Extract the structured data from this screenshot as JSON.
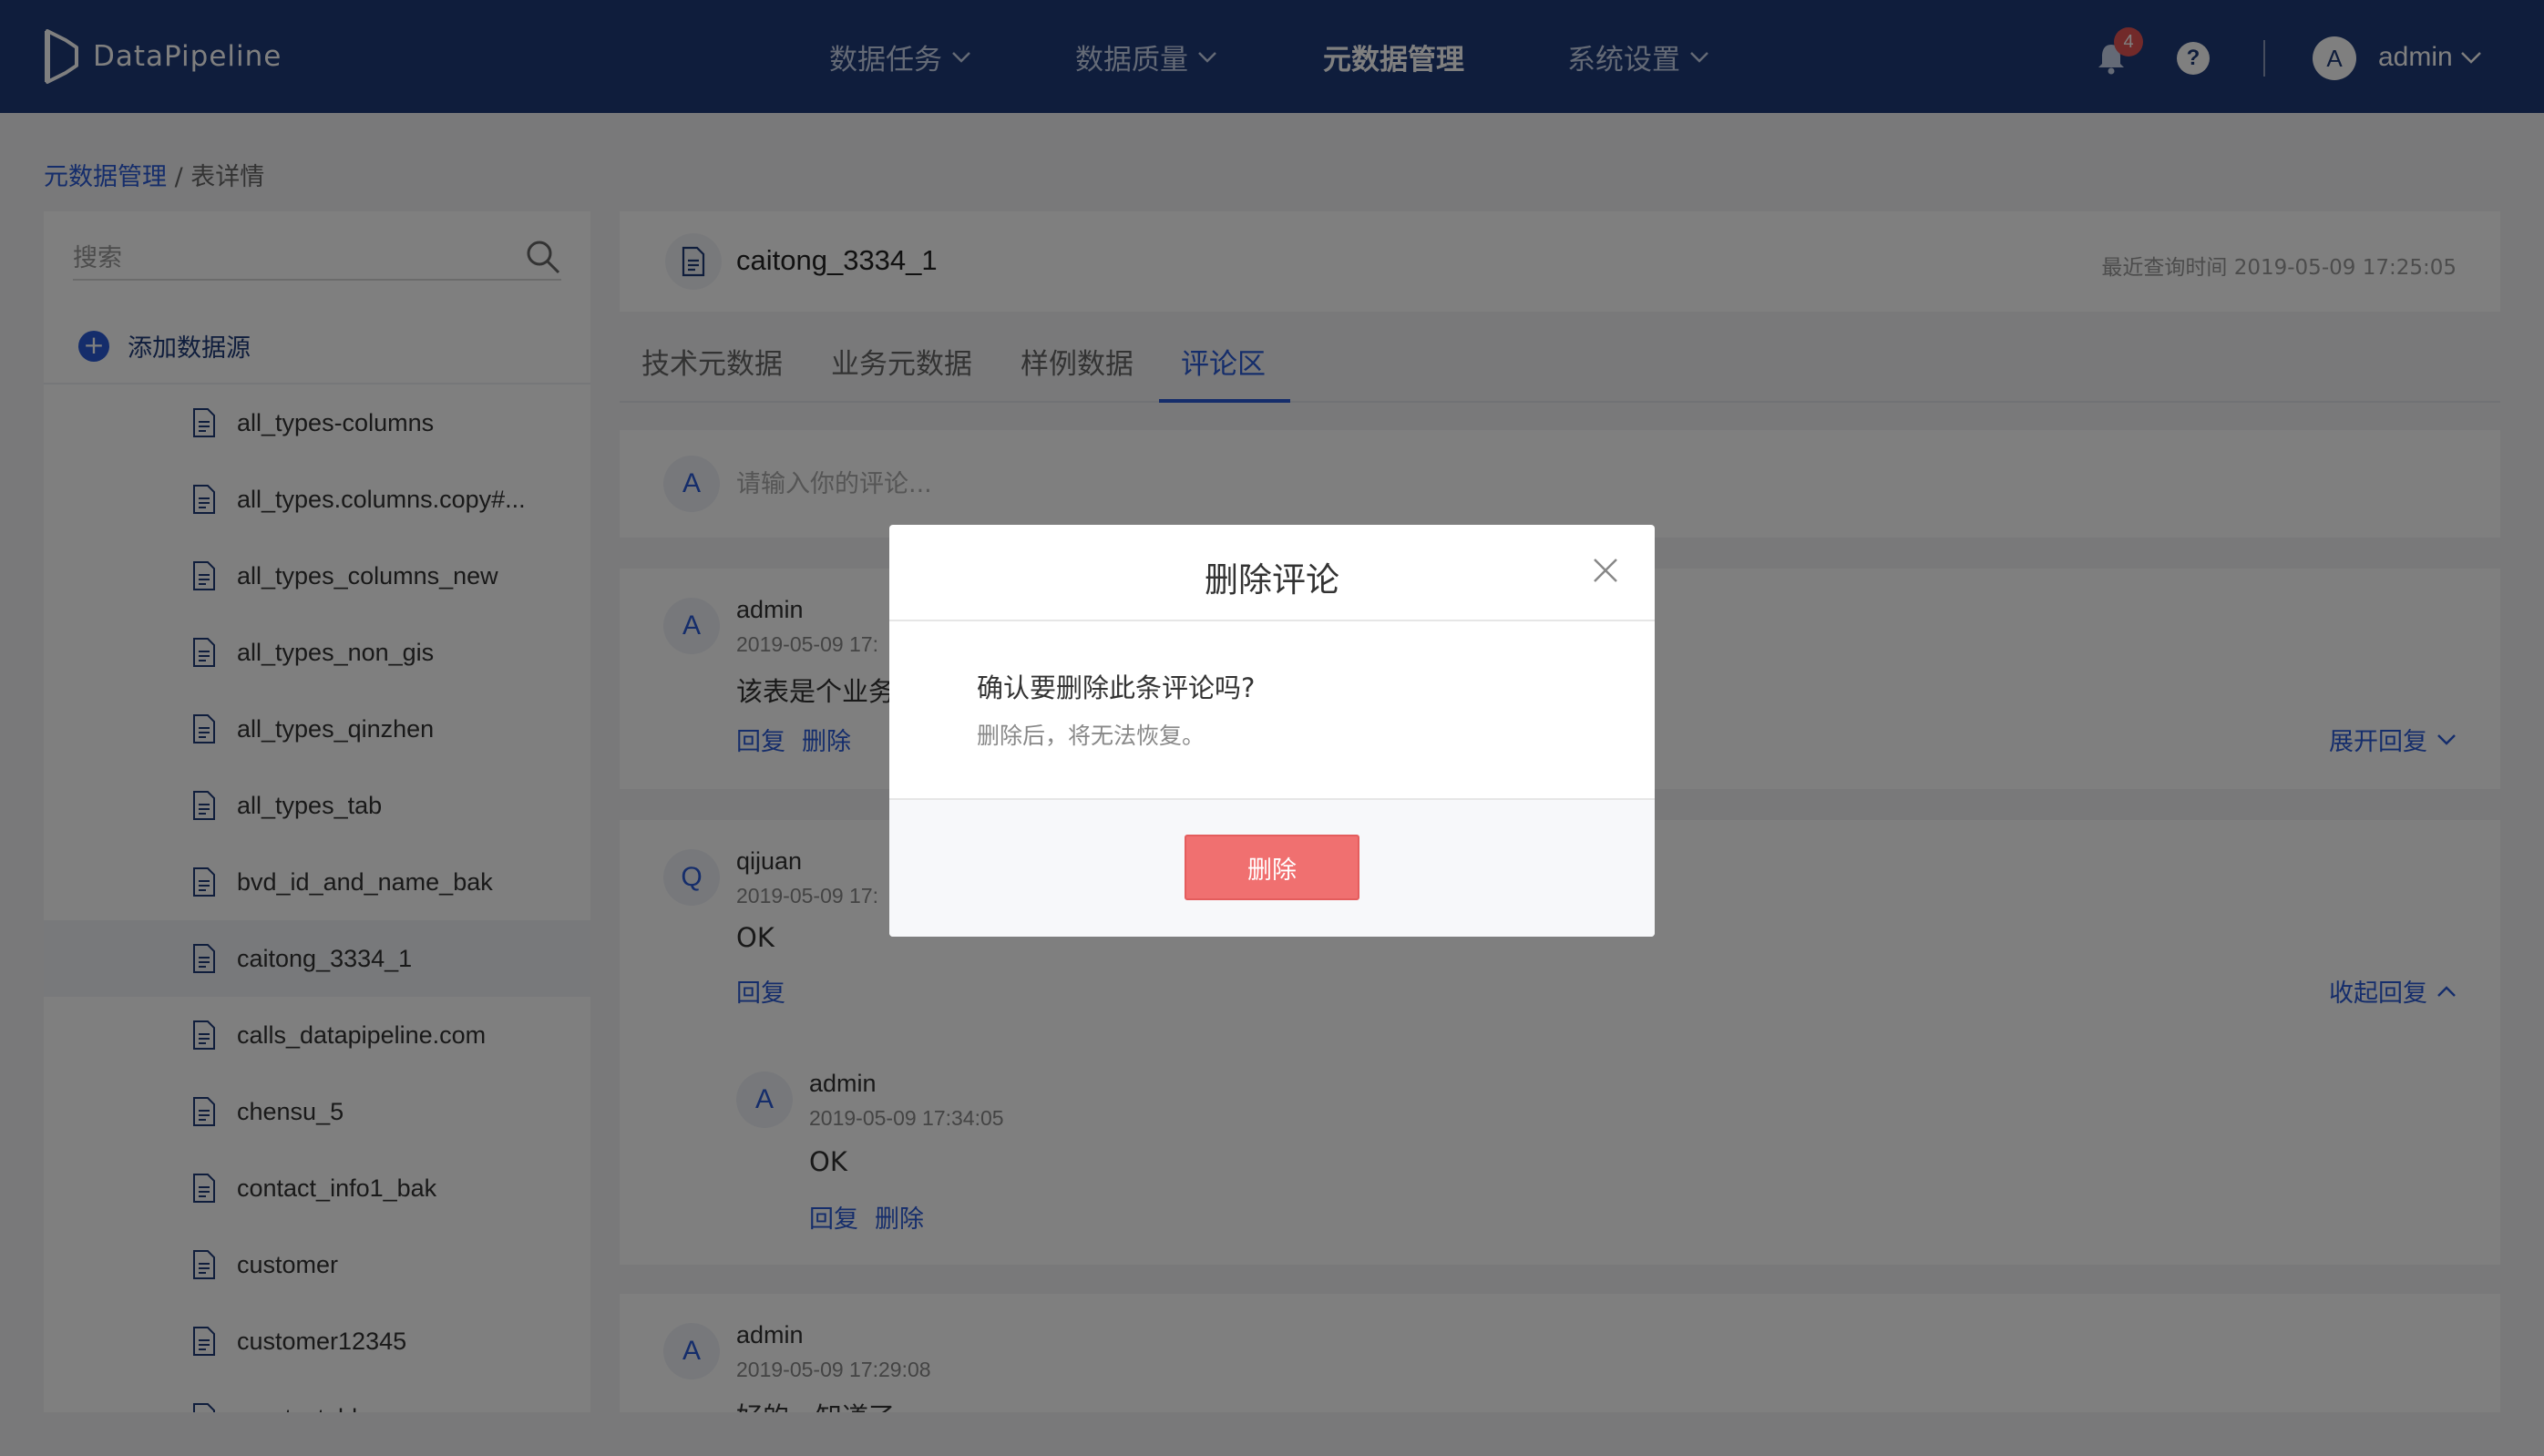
{
  "app": {
    "name": "DataPipeline"
  },
  "nav": {
    "items": [
      {
        "label": "数据任务"
      },
      {
        "label": "数据质量"
      },
      {
        "label": "元数据管理"
      },
      {
        "label": "系统设置"
      }
    ],
    "notification_count": "4",
    "help": "?",
    "user_initial": "A",
    "user_name": "admin"
  },
  "breadcrumb": {
    "parent": "元数据管理",
    "separator": "/",
    "current": "表详情"
  },
  "sidebar": {
    "search_placeholder": "搜索",
    "add_source_label": "添加数据源",
    "add_source_icon": "+",
    "items": [
      {
        "label": "all_types-columns"
      },
      {
        "label": "all_types.columns.copy#..."
      },
      {
        "label": "all_types_columns_new"
      },
      {
        "label": "all_types_non_gis"
      },
      {
        "label": "all_types_qinzhen"
      },
      {
        "label": "all_types_tab"
      },
      {
        "label": "bvd_id_and_name_bak"
      },
      {
        "label": "caitong_3334_1",
        "active": true
      },
      {
        "label": "calls_datapipeline.com"
      },
      {
        "label": "chensu_5"
      },
      {
        "label": "contact_info1_bak"
      },
      {
        "label": "customer"
      },
      {
        "label": "customer12345"
      },
      {
        "label": "empty_table"
      }
    ]
  },
  "detail": {
    "table_name": "caitong_3334_1",
    "last_query": "最近查询时间 2019-05-09 17:25:05",
    "tabs": [
      {
        "label": "技术元数据"
      },
      {
        "label": "业务元数据"
      },
      {
        "label": "样例数据"
      },
      {
        "label": "评论区",
        "active": true
      }
    ]
  },
  "comments": {
    "input_avatar": "A",
    "input_placeholder": "请输入你的评论...",
    "list": [
      {
        "avatar": "A",
        "author": "admin",
        "time": "2019-05-09 17:",
        "text": "该表是个业务",
        "reply": "回复",
        "delete": "删除",
        "toggle": "展开回复"
      },
      {
        "avatar": "Q",
        "author": "qijuan",
        "time": "2019-05-09 17:",
        "text": "OK",
        "reply": "回复",
        "toggle": "收起回复",
        "replies": [
          {
            "avatar": "A",
            "author": "admin",
            "time": "2019-05-09 17:34:05",
            "text": "OK",
            "reply": "回复",
            "delete": "删除"
          }
        ]
      },
      {
        "avatar": "A",
        "author": "admin",
        "time": "2019-05-09 17:29:08",
        "text": "好的，知道了"
      }
    ]
  },
  "modal": {
    "title": "删除评论",
    "message": "确认要删除此条评论吗?",
    "submessage": "删除后，将无法恢复。",
    "confirm_label": "删除",
    "close_icon": "close-icon"
  },
  "colors": {
    "nav_bg": "#1f3a78",
    "accent": "#2a5bd7",
    "danger": "#f07070",
    "page_bg": "#f2f3f5"
  }
}
